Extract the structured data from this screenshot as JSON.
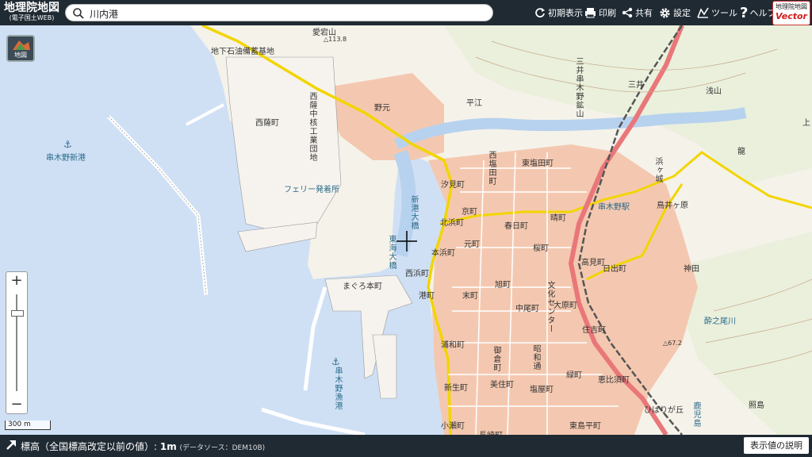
{
  "header": {
    "logo_title": "地理院地図",
    "logo_subtitle": "(電子国土WEB)",
    "search_value": "川内港",
    "tools": [
      {
        "label": "初期表示",
        "icon": "reload-icon"
      },
      {
        "label": "印刷",
        "icon": "printer-icon"
      },
      {
        "label": "共有",
        "icon": "share-icon"
      },
      {
        "label": "設定",
        "icon": "gear-icon"
      },
      {
        "label": "ツール",
        "icon": "tool-icon"
      },
      {
        "label": "ヘルプ",
        "icon": "help-icon"
      }
    ],
    "badge_line1": "地理院地図",
    "badge_line2": "Vector"
  },
  "map": {
    "layer_button_label": "地図",
    "scale_label": "300 m",
    "labels_h": [
      {
        "id": "chika",
        "text": "地下石油備蓄基地"
      },
      {
        "id": "atago",
        "text": "愛宕山"
      },
      {
        "id": "h1138",
        "text": "△113.8"
      },
      {
        "id": "nishisatsu",
        "text": "西薩町"
      },
      {
        "id": "kushikino_shinko",
        "text": "串木野新港"
      },
      {
        "id": "ferry",
        "text": "フェリー発着所"
      },
      {
        "id": "nomoto",
        "text": "野元"
      },
      {
        "id": "hirae",
        "text": "平江"
      },
      {
        "id": "mii",
        "text": "三井"
      },
      {
        "id": "asayama",
        "text": "浅山"
      },
      {
        "id": "higashi_shioda",
        "text": "東塩田町"
      },
      {
        "id": "shiomi",
        "text": "汐見町"
      },
      {
        "id": "kyo",
        "text": "京町"
      },
      {
        "id": "kasuga",
        "text": "春日町"
      },
      {
        "id": "hare",
        "text": "晴町"
      },
      {
        "id": "kushikino_eki",
        "text": "串木野駅"
      },
      {
        "id": "torii",
        "text": "鳥井ヶ原"
      },
      {
        "id": "moto",
        "text": "元町"
      },
      {
        "id": "sakura",
        "text": "桜町"
      },
      {
        "id": "hide",
        "text": "日出町"
      },
      {
        "id": "kamida",
        "text": "神田"
      },
      {
        "id": "maguro",
        "text": "まぐろ本町"
      },
      {
        "id": "minato",
        "text": "港町"
      },
      {
        "id": "suemachi",
        "text": "末町"
      },
      {
        "id": "asahi",
        "text": "旭町"
      },
      {
        "id": "nakao",
        "text": "中尾町"
      },
      {
        "id": "oohara",
        "text": "大原町"
      },
      {
        "id": "takami",
        "text": "高見町"
      },
      {
        "id": "suinoo",
        "text": "酔之尾川"
      },
      {
        "id": "urawa",
        "text": "浦和町"
      },
      {
        "id": "sumiyoshi",
        "text": "住吉町"
      },
      {
        "id": "h672",
        "text": "△67.2"
      },
      {
        "id": "midori",
        "text": "緑町"
      },
      {
        "id": "ebisu",
        "text": "恵比須町"
      },
      {
        "id": "biryo",
        "text": "美住町"
      },
      {
        "id": "shioya",
        "text": "塩屋町"
      },
      {
        "id": "shinsei",
        "text": "新生町"
      },
      {
        "id": "kose",
        "text": "小瀬町"
      },
      {
        "id": "nagasaki",
        "text": "長崎町"
      },
      {
        "id": "higashi_shima",
        "text": "東島平町"
      },
      {
        "id": "teruma",
        "text": "照島"
      },
      {
        "id": "hibarigaoka",
        "text": "ひばりが丘"
      },
      {
        "id": "ue",
        "text": "上"
      },
      {
        "id": "tatsu",
        "text": "龍"
      },
      {
        "id": "nishihama",
        "text": "西浜町"
      },
      {
        "id": "mihama",
        "text": "本浜町"
      },
      {
        "id": "kitahama",
        "text": "北浜町"
      }
    ],
    "labels_v": [
      {
        "id": "nishisatsu_kogyo",
        "text": "西薩中核工業団地"
      },
      {
        "id": "nishi_shioda",
        "text": "西塩田町"
      },
      {
        "id": "mii_kushiki",
        "text": "三井串木野鉱山"
      },
      {
        "id": "shinko_ohashi",
        "text": "新港大橋"
      },
      {
        "id": "higashikai",
        "text": "東海大橋"
      },
      {
        "id": "bunka",
        "text": "文化センター"
      },
      {
        "id": "showa",
        "text": "昭和通"
      },
      {
        "id": "gokura",
        "text": "御倉町"
      },
      {
        "id": "kushikino_gyoko",
        "text": "串木野漁港"
      },
      {
        "id": "hamagake",
        "text": "浜ヶ城"
      },
      {
        "id": "kagoshima",
        "text": "鹿児島"
      }
    ]
  },
  "footer": {
    "elevation_text": "標高（全国標高改定以前の値）: ",
    "elevation_value": "1m",
    "source": "(データソース：DEM10B)",
    "help_button": "表示値の説明"
  }
}
